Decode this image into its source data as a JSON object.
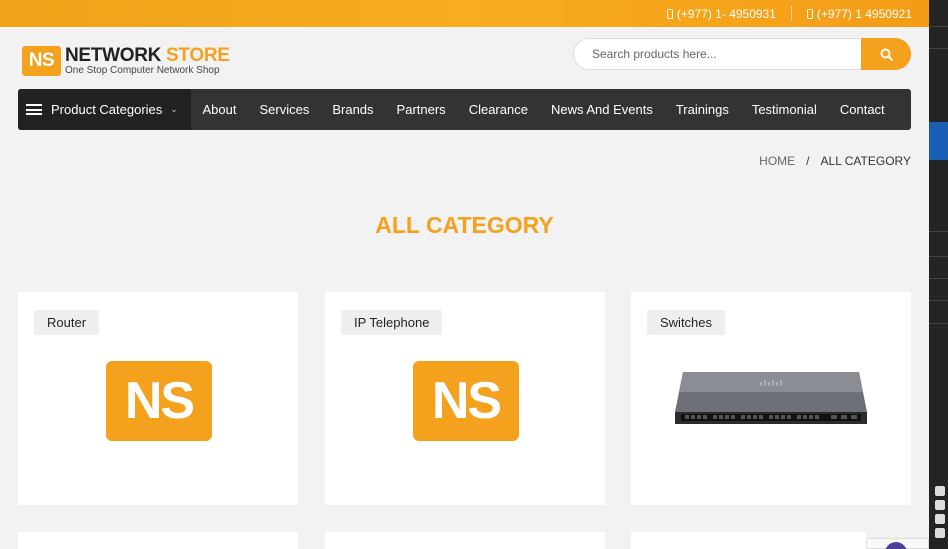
{
  "topbar": {
    "phone1": "(+977) 1- 4950931",
    "phone2": "(+977) 1 4950921"
  },
  "logo": {
    "badge": "NS",
    "title_part1": "NETWORK ",
    "title_part2": "STORE",
    "tagline": "One Stop Computer Network Shop"
  },
  "search": {
    "placeholder": "Search products here..."
  },
  "nav": {
    "categories_label": "Product Categories",
    "items": [
      "About",
      "Services",
      "Brands",
      "Partners",
      "Clearance",
      "News And Events",
      "Trainings",
      "Testimonial",
      "Contact"
    ]
  },
  "breadcrumb": {
    "home": "HOME",
    "separator": "/",
    "current": "ALL CATEGORY"
  },
  "page": {
    "title": "ALL CATEGORY"
  },
  "categories": [
    {
      "label": "Router",
      "image": "ns-logo"
    },
    {
      "label": "IP Telephone",
      "image": "ns-logo"
    },
    {
      "label": "Switches",
      "image": "cisco-switch"
    }
  ],
  "placeholder_logo_text": "NS",
  "colors": {
    "accent": "#f4a11e",
    "nav_bg": "#333333",
    "page_bg": "#f2f2f2"
  }
}
